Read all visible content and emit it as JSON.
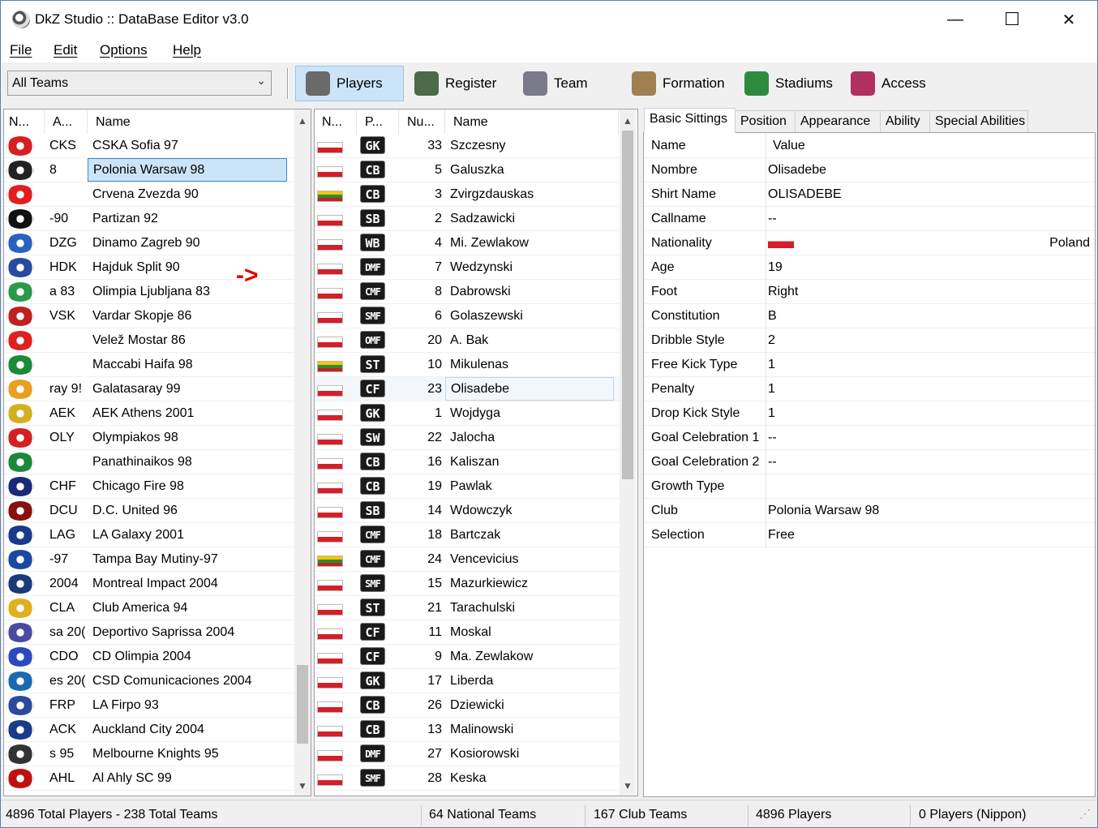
{
  "window": {
    "title": "DkZ Studio :: DataBase Editor v3.0",
    "minimize": "—",
    "maximize": "☐",
    "close": "✕"
  },
  "menu": [
    "File",
    "Edit",
    "Options",
    "Help"
  ],
  "toolbar": {
    "team_filter": "All Teams",
    "buttons": [
      {
        "label": "Players",
        "icon": "player-icon",
        "color": "#6a6a6a",
        "active": true
      },
      {
        "label": "Register",
        "icon": "register-icon",
        "color": "#4a6a4a",
        "active": false
      },
      {
        "label": "Team",
        "icon": "team-icon",
        "color": "#7a7a8a",
        "active": false
      },
      {
        "label": "Formation",
        "icon": "formation-icon",
        "color": "#a08050",
        "active": false
      },
      {
        "label": "Stadiums",
        "icon": "stadiums-icon",
        "color": "#2e8b3e",
        "active": false
      },
      {
        "label": "Access",
        "icon": "access-icon",
        "color": "#b03060",
        "active": false
      }
    ]
  },
  "teams": {
    "headers": [
      "N...",
      "A...",
      "Name"
    ],
    "selected_index": 1,
    "rows": [
      {
        "abbr": "CKS",
        "name": "CSKA Sofia 97",
        "crest": "#d42020"
      },
      {
        "abbr": "8",
        "name": "Polonia Warsaw 98",
        "crest": "#222222"
      },
      {
        "abbr": "",
        "name": "Crvena Zvezda 90",
        "crest": "#e02020"
      },
      {
        "abbr": "-90",
        "name": "Partizan 92",
        "crest": "#111111"
      },
      {
        "abbr": "DZG",
        "name": "Dinamo Zagreb 90",
        "crest": "#2a62c0"
      },
      {
        "abbr": "HDK",
        "name": "Hajduk Split 90",
        "crest": "#2a4aa0"
      },
      {
        "abbr": "a 83",
        "name": "Olimpia Ljubljana 83",
        "crest": "#2a9a4a"
      },
      {
        "abbr": "VSK",
        "name": "Vardar Skopje 86",
        "crest": "#c02020"
      },
      {
        "abbr": "",
        "name": "Velež Mostar 86",
        "crest": "#e02020"
      },
      {
        "abbr": "",
        "name": "Maccabi Haifa 98",
        "crest": "#1a8a3a"
      },
      {
        "abbr": "ray 9!",
        "name": "Galatasaray 99",
        "crest": "#e8a020"
      },
      {
        "abbr": "AEK",
        "name": "AEK Athens 2001",
        "crest": "#d4b020"
      },
      {
        "abbr": "OLY",
        "name": "Olympiakos 98",
        "crest": "#d42020"
      },
      {
        "abbr": "",
        "name": "Panathinaikos 98",
        "crest": "#1a8a3a"
      },
      {
        "abbr": "CHF",
        "name": "Chicago Fire 98",
        "crest": "#1a2a7a"
      },
      {
        "abbr": "DCU",
        "name": "D.C. United 96",
        "crest": "#8a1010"
      },
      {
        "abbr": "LAG",
        "name": "LA Galaxy 2001",
        "crest": "#1a3a8a"
      },
      {
        "abbr": "-97",
        "name": "Tampa Bay Mutiny-97",
        "crest": "#1a4aa0"
      },
      {
        "abbr": "2004",
        "name": "Montreal Impact 2004",
        "crest": "#1a3a7a"
      },
      {
        "abbr": "CLA",
        "name": "Club America 94",
        "crest": "#e0b020"
      },
      {
        "abbr": "sa 20(",
        "name": "Deportivo Saprissa 2004",
        "crest": "#4a4aa0"
      },
      {
        "abbr": "CDO",
        "name": "CD Olimpia 2004",
        "crest": "#2a4ac0"
      },
      {
        "abbr": "es 20(",
        "name": "CSD Comunicaciones 2004",
        "crest": "#1a6ab0"
      },
      {
        "abbr": "FRP",
        "name": "LA Firpo 93",
        "crest": "#2a4aa0"
      },
      {
        "abbr": "ACK",
        "name": "Auckland City 2004",
        "crest": "#1a3a8a"
      },
      {
        "abbr": "s 95",
        "name": "Melbourne Knights 95",
        "crest": "#333333"
      },
      {
        "abbr": "AHL",
        "name": "Al Ahly SC 99",
        "crest": "#c01010"
      }
    ]
  },
  "arrow_annotation": "->",
  "players": {
    "headers": [
      "N...",
      "P...",
      "Nu...",
      "Name"
    ],
    "selected_index": 10,
    "rows": [
      {
        "flag": "pl",
        "pos": "GK",
        "num": "33",
        "name": "Szczesny"
      },
      {
        "flag": "pl",
        "pos": "CB",
        "num": "5",
        "name": "Galuszka"
      },
      {
        "flag": "lt",
        "pos": "CB",
        "num": "3",
        "name": "Zvirgzdauskas"
      },
      {
        "flag": "pl",
        "pos": "SB",
        "num": "2",
        "name": "Sadzawicki"
      },
      {
        "flag": "pl",
        "pos": "WB",
        "num": "4",
        "name": "Mi. Zewlakow"
      },
      {
        "flag": "pl",
        "pos": "DMF",
        "num": "7",
        "name": "Wedzynski"
      },
      {
        "flag": "pl",
        "pos": "CMF",
        "num": "8",
        "name": "Dabrowski"
      },
      {
        "flag": "pl",
        "pos": "SMF",
        "num": "6",
        "name": "Golaszewski"
      },
      {
        "flag": "pl",
        "pos": "OMF",
        "num": "20",
        "name": "A. Bak"
      },
      {
        "flag": "lt",
        "pos": "ST",
        "num": "10",
        "name": "Mikulenas"
      },
      {
        "flag": "pl",
        "pos": "CF",
        "num": "23",
        "name": "Olisadebe"
      },
      {
        "flag": "pl",
        "pos": "GK",
        "num": "1",
        "name": "Wojdyga"
      },
      {
        "flag": "pl",
        "pos": "SW",
        "num": "22",
        "name": "Jalocha"
      },
      {
        "flag": "pl",
        "pos": "CB",
        "num": "16",
        "name": "Kaliszan"
      },
      {
        "flag": "pl",
        "pos": "CB",
        "num": "19",
        "name": "Pawlak"
      },
      {
        "flag": "pl",
        "pos": "SB",
        "num": "14",
        "name": "Wdowczyk"
      },
      {
        "flag": "pl",
        "pos": "CMF",
        "num": "18",
        "name": "Bartczak"
      },
      {
        "flag": "lt",
        "pos": "CMF",
        "num": "24",
        "name": "Vencevicius"
      },
      {
        "flag": "pl",
        "pos": "SMF",
        "num": "15",
        "name": "Mazurkiewicz"
      },
      {
        "flag": "pl",
        "pos": "ST",
        "num": "21",
        "name": "Tarachulski"
      },
      {
        "flag": "pl",
        "pos": "CF",
        "num": "11",
        "name": "Moskal"
      },
      {
        "flag": "pl",
        "pos": "CF",
        "num": "9",
        "name": "Ma. Zewlakow"
      },
      {
        "flag": "pl",
        "pos": "GK",
        "num": "17",
        "name": "Liberda"
      },
      {
        "flag": "pl",
        "pos": "CB",
        "num": "26",
        "name": "Dziewicki"
      },
      {
        "flag": "pl",
        "pos": "CB",
        "num": "13",
        "name": "Malinowski"
      },
      {
        "flag": "pl",
        "pos": "DMF",
        "num": "27",
        "name": "Kosiorowski"
      },
      {
        "flag": "pl",
        "pos": "SMF",
        "num": "28",
        "name": "Keska"
      }
    ]
  },
  "tabs": [
    "Basic Sittings",
    "Position",
    "Appearance",
    "Ability",
    "Special Abilities"
  ],
  "properties": {
    "header": {
      "key": "Name",
      "value": "Value"
    },
    "rows": [
      {
        "key": "Nombre",
        "value": "Olisadebe"
      },
      {
        "key": "Shirt Name",
        "value": "OLISADEBE"
      },
      {
        "key": "Callname",
        "value": "--"
      },
      {
        "key": "Nationality",
        "value": "Poland",
        "flag": "pl"
      },
      {
        "key": "Age",
        "value": "19"
      },
      {
        "key": "Foot",
        "value": "Right"
      },
      {
        "key": "Constitution",
        "value": "B"
      },
      {
        "key": "Dribble Style",
        "value": "2"
      },
      {
        "key": "Free Kick Type",
        "value": "1"
      },
      {
        "key": "Penalty",
        "value": "1"
      },
      {
        "key": "Drop Kick Style",
        "value": "1"
      },
      {
        "key": "Goal Celebration 1",
        "value": "--"
      },
      {
        "key": "Goal Celebration 2",
        "value": "--"
      },
      {
        "key": "Growth Type",
        "value": ""
      },
      {
        "key": "Club",
        "value": "Polonia Warsaw 98"
      },
      {
        "key": "Selection",
        "value": "Free"
      }
    ]
  },
  "status": [
    "4896 Total Players  -  238 Total Teams",
    "64 National Teams",
    "167 Club Teams",
    "4896 Players",
    "0 Players (Nippon)"
  ]
}
